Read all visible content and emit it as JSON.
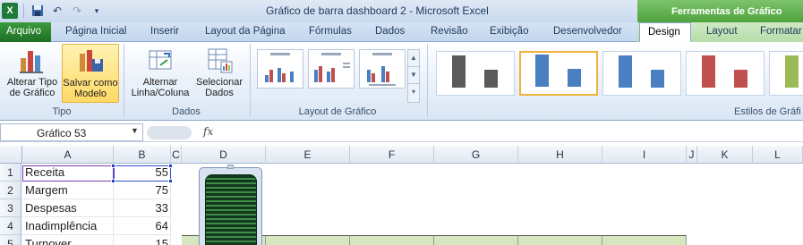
{
  "window": {
    "title": "Gráfico de barra dashboard 2  -  Microsoft Excel",
    "tools_context": "Ferramentas de Gráfico"
  },
  "qat": {
    "icons": [
      "excel-icon",
      "save-icon",
      "undo-icon",
      "redo-icon",
      "customize-icon"
    ]
  },
  "tabs": [
    {
      "label": "Arquivo"
    },
    {
      "label": "Página Inicial"
    },
    {
      "label": "Inserir"
    },
    {
      "label": "Layout da Página"
    },
    {
      "label": "Fórmulas"
    },
    {
      "label": "Dados"
    },
    {
      "label": "Revisão"
    },
    {
      "label": "Exibição"
    },
    {
      "label": "Desenvolvedor"
    },
    {
      "label": "Design"
    },
    {
      "label": "Layout"
    },
    {
      "label": "Formatar"
    }
  ],
  "ribbon": {
    "groups": {
      "tipo": {
        "label": "Tipo",
        "btn1_line1": "Alterar Tipo",
        "btn1_line2": "de Gráfico",
        "btn2_line1": "Salvar como",
        "btn2_line2": "Modelo"
      },
      "dados": {
        "label": "Dados",
        "btn1_line1": "Alternar",
        "btn1_line2": "Linha/Coluna",
        "btn2_line1": "Selecionar",
        "btn2_line2": "Dados"
      },
      "layout": {
        "label": "Layout de Gráfico"
      },
      "estilos": {
        "label": "Estilos de Gráfi"
      }
    },
    "styles_colors": [
      "#5a5a5a",
      "#4a7fc1",
      "#4a7fc1",
      "#c0504d",
      "#9bbb59"
    ]
  },
  "formula_bar": {
    "name_box": "Gráfico 53",
    "fx": "fx",
    "formula": ""
  },
  "columns": [
    "A",
    "B",
    "C",
    "D",
    "E",
    "F",
    "G",
    "H",
    "I",
    "J",
    "K",
    "L"
  ],
  "rows": [
    {
      "num": "1",
      "label": "Receita",
      "value": "55"
    },
    {
      "num": "2",
      "label": "Margem",
      "value": "75"
    },
    {
      "num": "3",
      "label": "Despesas",
      "value": "33"
    },
    {
      "num": "4",
      "label": "Inadimplência",
      "value": "64"
    },
    {
      "num": "5",
      "label": "Turnover",
      "value": "15"
    }
  ]
}
